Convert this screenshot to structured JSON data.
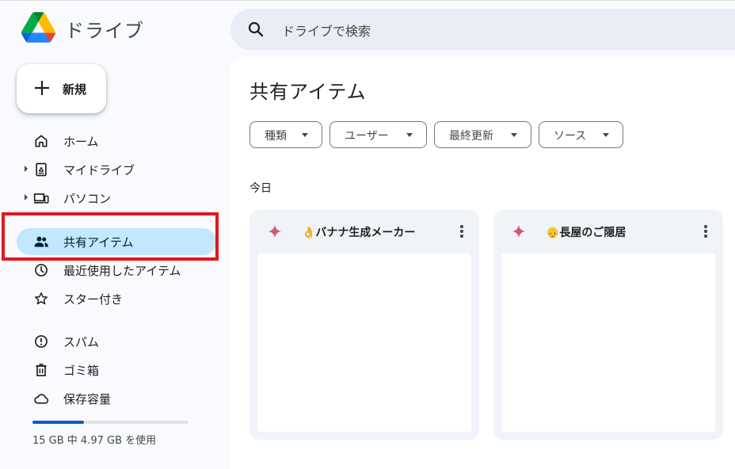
{
  "app": {
    "title": "ドライブ",
    "logo_icon": "google-drive-logo"
  },
  "search": {
    "placeholder": "ドライブで検索",
    "icon": "search-icon"
  },
  "new_button": {
    "label": "新規",
    "icon": "plus-icon"
  },
  "sidebar": {
    "items": [
      {
        "label": "ホーム",
        "icon": "home-icon",
        "active": false,
        "expandable": false
      },
      {
        "label": "マイドライブ",
        "icon": "my-drive-icon",
        "active": false,
        "expandable": true
      },
      {
        "label": "パソコン",
        "icon": "computers-icon",
        "active": false,
        "expandable": true
      },
      {
        "label": "共有アイテム",
        "icon": "shared-people-icon",
        "active": true,
        "expandable": false
      },
      {
        "label": "最近使用したアイテム",
        "icon": "clock-icon",
        "active": false,
        "expandable": false
      },
      {
        "label": "スター付き",
        "icon": "star-icon",
        "active": false,
        "expandable": false
      },
      {
        "label": "スパム",
        "icon": "spam-icon",
        "active": false,
        "expandable": false
      },
      {
        "label": "ゴミ箱",
        "icon": "trash-icon",
        "active": false,
        "expandable": false
      },
      {
        "label": "保存容量",
        "icon": "cloud-icon",
        "active": false,
        "expandable": false
      }
    ],
    "highlight_color": "#e0171f"
  },
  "storage": {
    "text": "15 GB 中 4.97 GB を使用",
    "used_fraction": 0.331
  },
  "main": {
    "title": "共有アイテム",
    "filters": [
      {
        "label": "種類"
      },
      {
        "label": "ユーザー"
      },
      {
        "label": "最終更新"
      },
      {
        "label": "ソース"
      }
    ],
    "section_label": "今日",
    "cards": [
      {
        "title": "👌バナナ生成メーカー",
        "icon": "gemini-sparkle-icon"
      },
      {
        "title": "👴長屋のご隠居",
        "icon": "gemini-sparkle-icon"
      }
    ]
  },
  "colors": {
    "accent": "#0b57d0",
    "active_nav_bg": "#c2e7ff",
    "search_bg": "#e9eef6",
    "page_bg": "#f8fafd"
  }
}
